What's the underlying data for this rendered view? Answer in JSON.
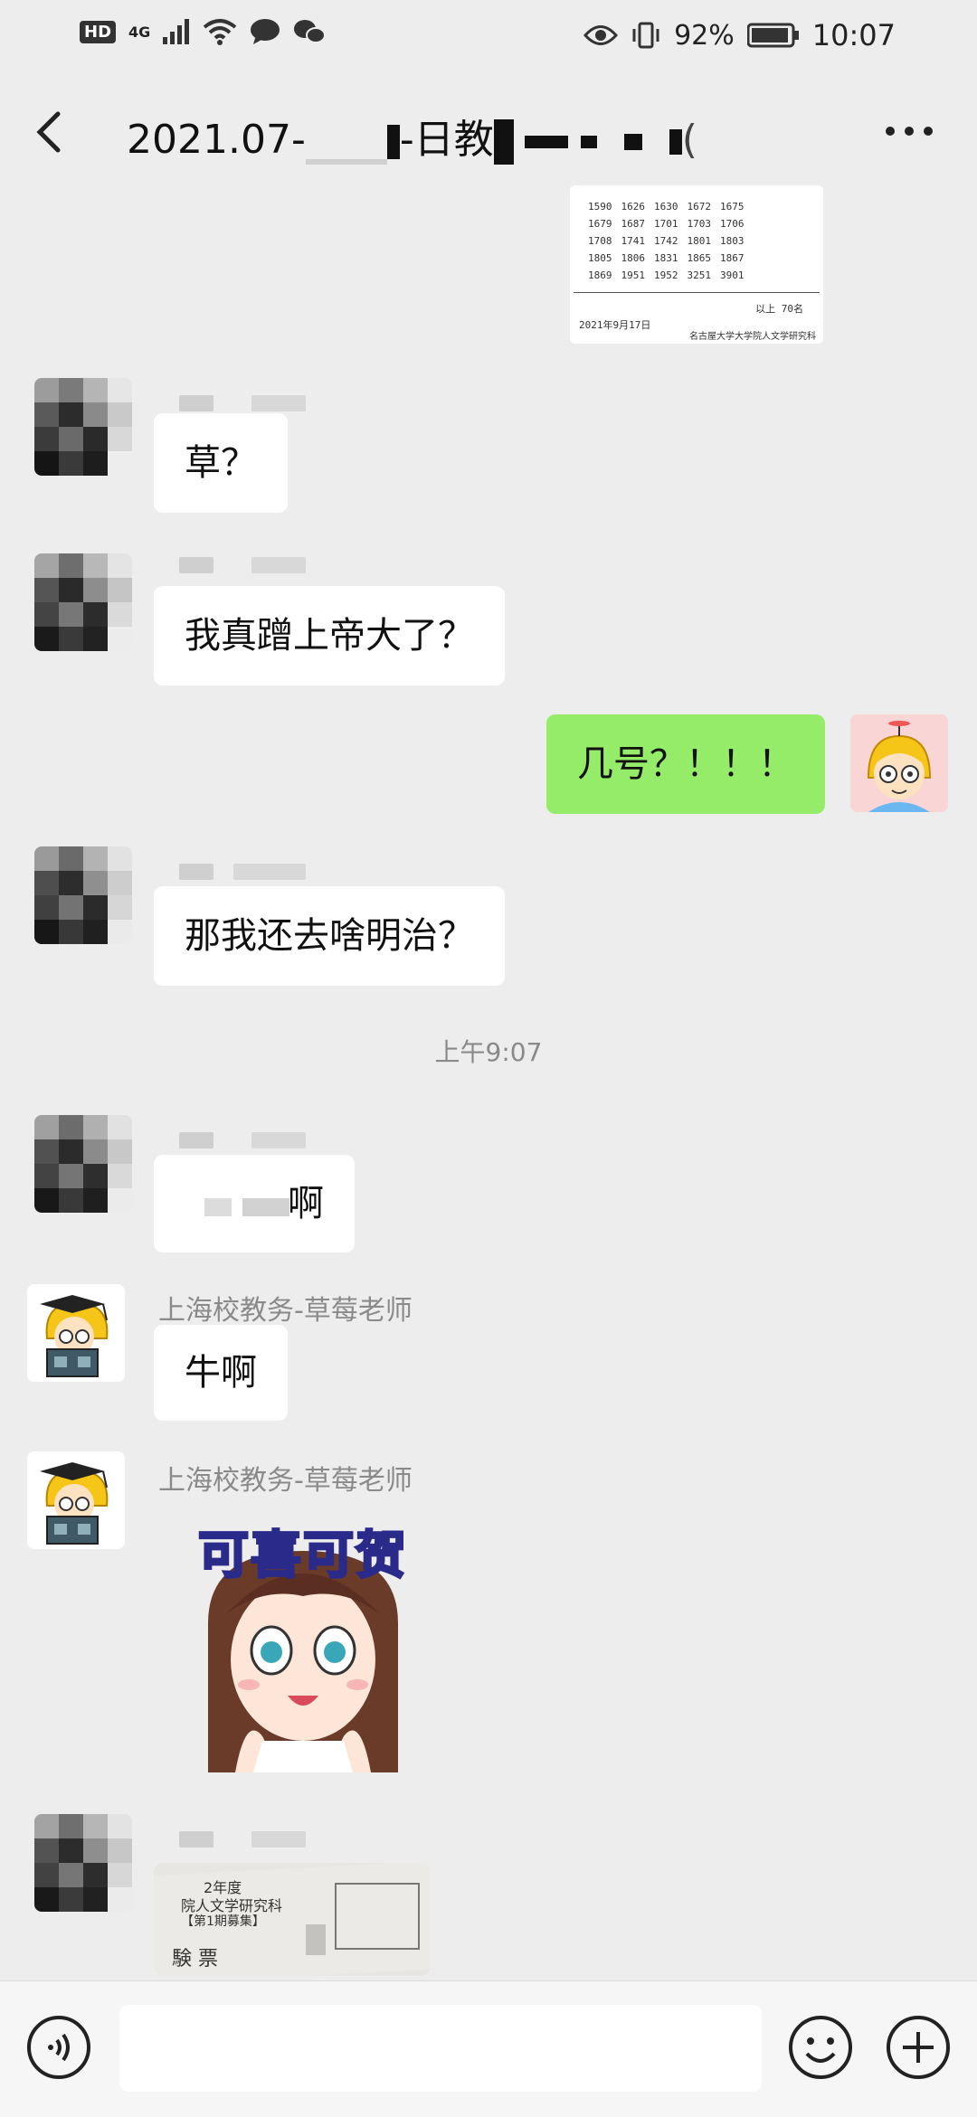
{
  "status_bar": {
    "network_badge": "HD",
    "network_type": "4G",
    "battery_percent": "92%",
    "time": "10:07"
  },
  "header": {
    "title_prefix": "2021.07-",
    "title_middle": "-日教",
    "title_suffix": "(",
    "back_icon": "chevron-left-icon",
    "more_icon": "more-dots-icon"
  },
  "top_image": {
    "rows": [
      [
        "1590",
        "1626",
        "1630",
        "1672",
        "1675"
      ],
      [
        "1679",
        "1687",
        "1701",
        "1703",
        "1706"
      ],
      [
        "1708",
        "1741",
        "1742",
        "1801",
        "1803"
      ],
      [
        "1805",
        "1806",
        "1831",
        "1865",
        "1867"
      ],
      [
        "1869",
        "1951",
        "1952",
        "3251",
        "3901"
      ]
    ],
    "total": "以上 70名",
    "date": "2021年9月17日",
    "institution": "名古屋大学大学院人文学研究科"
  },
  "messages": [
    {
      "text": "草？"
    },
    {
      "text": "我真蹭上帝大了？"
    },
    {
      "text": "几号？！！！"
    },
    {
      "text": "那我还去啥明治？"
    },
    {
      "text": "啊"
    },
    {
      "sender": "上海校教务-草莓老师",
      "text": "牛啊"
    },
    {
      "sender": "上海校教务-草莓老师",
      "sticker_text": "可喜可贺"
    }
  ],
  "timestamp": "上午9:07",
  "bottom_photo": {
    "line1": "2年度",
    "line2": "院人文学研究科",
    "line3": "【第1期募集】",
    "line4": "験 票"
  },
  "input_bar": {
    "voice_icon": "voice-icon",
    "emoji_icon": "emoji-icon",
    "plus_icon": "plus-icon"
  }
}
